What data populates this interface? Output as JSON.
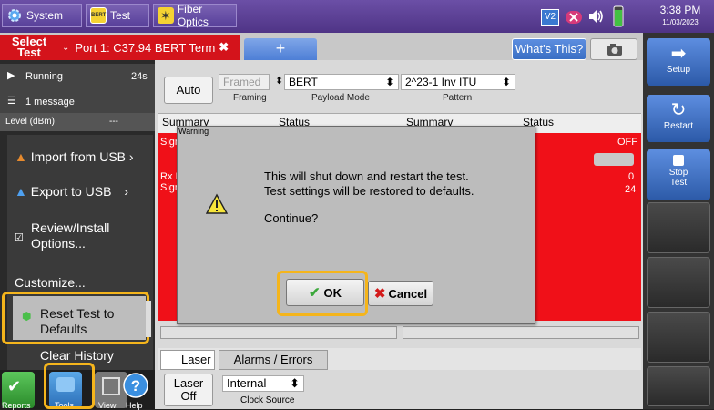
{
  "topbar": {
    "system_label": "System",
    "test_label": "Test",
    "fiber_label": "Fiber Optics",
    "badge_v2": "V2",
    "time": "3:38 PM",
    "date": "11/03/2023"
  },
  "tabs": {
    "select_test_line1": "Select",
    "select_test_line2": "Test",
    "port_tab": "Port 1: C37.94 BERT Term",
    "add_tab": "+",
    "whats_this": "What's This?"
  },
  "status": {
    "running": "Running",
    "running_time": "24s",
    "messages": "1 message",
    "level_label": "Level (dBm)",
    "level_value": "---"
  },
  "menu": {
    "import_usb": "Import from USB",
    "export_usb": "Export to USB",
    "review_line1": "Review/Install",
    "review_line2": "Options...",
    "customize": "Customize...",
    "reset_line1": "Reset Test to",
    "reset_line2": "Defaults",
    "clear_history": "Clear History"
  },
  "bottom_tools": {
    "reports": "Reports",
    "tools": "Tools",
    "view": "View",
    "help": "Help"
  },
  "right_panel": {
    "setup": "Setup",
    "restart": "Restart",
    "stop_line1": "Stop",
    "stop_line2": "Test"
  },
  "config": {
    "auto": "Auto",
    "framing_value": "Framed",
    "framing_label": "Framing",
    "payload_value": "BERT",
    "payload_label": "Payload Mode",
    "pattern_value": "2^23-1 Inv ITU",
    "pattern_label": "Pattern"
  },
  "panes": {
    "left_summary": "Summary",
    "left_status": "Status",
    "right_summary": "Summary",
    "right_status": "Status",
    "off": "OFF",
    "val1": "0",
    "val2": "24",
    "sig_short": "Sign",
    "rx_short": "Rx I",
    "sig2_short": "Sign"
  },
  "bottom_tabs": {
    "laser_tab": "Laser",
    "alarms_tab": "Alarms / Errors",
    "laser_off_line1": "Laser",
    "laser_off_line2": "Off",
    "clock_value": "Internal",
    "clock_label": "Clock Source"
  },
  "dialog": {
    "title": "Warning",
    "line1": "This will shut down and restart the test.",
    "line2": "Test settings will be restored to defaults.",
    "line3": "Continue?",
    "ok": "OK",
    "cancel": "Cancel"
  }
}
